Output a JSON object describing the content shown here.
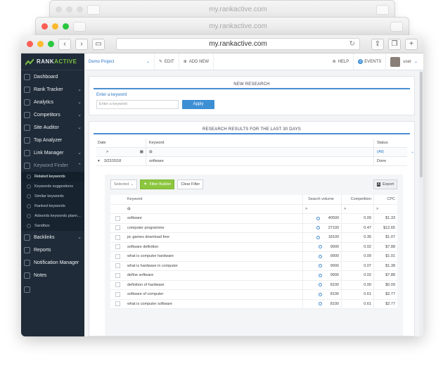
{
  "browser": {
    "url": "my.rankactive.com"
  },
  "sidebar": {
    "brand": {
      "prefix": "RANK",
      "suffix": "ACTIVE",
      "accent": "#7cc142"
    },
    "items": [
      {
        "label": "Dashboard",
        "icon": "gauge-icon",
        "chevron": false
      },
      {
        "label": "Rank Tracker",
        "icon": "chart-icon",
        "chevron": true
      },
      {
        "label": "Analytics",
        "icon": "analytics-icon",
        "chevron": true
      },
      {
        "label": "Competitors",
        "icon": "competitors-icon",
        "chevron": true
      },
      {
        "label": "Site Auditor",
        "icon": "auditor-icon",
        "chevron": true
      },
      {
        "label": "Top Analyzer",
        "icon": "analyzer-icon",
        "chevron": false
      },
      {
        "label": "Link Manager",
        "icon": "link-icon",
        "chevron": true
      },
      {
        "label": "Keyword Finder",
        "icon": "key-icon",
        "chevron": true
      }
    ],
    "sub_items": [
      {
        "label": "Related keywords",
        "active": true
      },
      {
        "label": "Keywords suggestions",
        "active": false
      },
      {
        "label": "Similar keywords",
        "active": false
      },
      {
        "label": "Ranked keywords",
        "active": false
      },
      {
        "label": "Adwords keywords plann...",
        "active": false
      },
      {
        "label": "Sandbox",
        "active": false
      }
    ],
    "items_bottom": [
      {
        "label": "Backlinks",
        "icon": "backlinks-icon",
        "chevron": true
      },
      {
        "label": "Reports",
        "icon": "reports-icon",
        "chevron": false
      },
      {
        "label": "Notification Manager",
        "icon": "bell-icon",
        "chevron": false
      },
      {
        "label": "Notes",
        "icon": "notes-icon",
        "chevron": false
      }
    ],
    "bg": "#1f2b38"
  },
  "topbar": {
    "project": "Demo Project",
    "edit": "EDIT",
    "add_new": "ADD NEW",
    "help": "HELP",
    "events": "EVENTS",
    "events_count": "0",
    "user": "user"
  },
  "research": {
    "title": "NEW RESEARCH",
    "label": "Enter a keyword",
    "placeholder": "Enter a keyword",
    "apply": "Apply"
  },
  "results": {
    "title": "RESEARCH RESULTS FOR THE LAST 30 DAYS",
    "headers": {
      "date": "Date",
      "keyword": "Keyword",
      "status": "Status"
    },
    "filter": {
      "date": ">",
      "keyword": "ф",
      "status": "(All)"
    },
    "row": {
      "date": "3/22/2018",
      "keyword": "software",
      "status": "Done"
    },
    "toolbar": {
      "selected": "Selected",
      "filter_builder": "Filter Builder",
      "clear_filter": "Clear Filter",
      "export": "Export"
    },
    "kw_headers": {
      "keyword": "Keyword",
      "volume": "Search volume",
      "competition": "Competition",
      "cpc": "CPC"
    },
    "kw_filter": {
      "keyword": "ф",
      "volume": ">",
      "competition": ">",
      "cpc": ">"
    },
    "keywords": [
      {
        "keyword": "software",
        "volume": "40500",
        "competition": "0.09",
        "cpc": "$1.33"
      },
      {
        "keyword": "computer programme",
        "volume": "27100",
        "competition": "0.47",
        "cpc": "$12.65"
      },
      {
        "keyword": "pc games download free",
        "volume": "18100",
        "competition": "0.35",
        "cpc": "$1.07"
      },
      {
        "keyword": "software definition",
        "volume": "9900",
        "competition": "0.02",
        "cpc": "$7.88"
      },
      {
        "keyword": "what is computer hardware",
        "volume": "9900",
        "competition": "0.09",
        "cpc": "$1.01"
      },
      {
        "keyword": "what is hardware in computer",
        "volume": "9900",
        "competition": "0.07",
        "cpc": "$1.38"
      },
      {
        "keyword": "define software",
        "volume": "9900",
        "competition": "0.02",
        "cpc": "$7.88"
      },
      {
        "keyword": "definition of hardware",
        "volume": "8100",
        "competition": "0.00",
        "cpc": "$0.09"
      },
      {
        "keyword": "software of computer",
        "volume": "8100",
        "competition": "0.61",
        "cpc": "$2.77"
      },
      {
        "keyword": "what is computer software",
        "volume": "8100",
        "competition": "0.61",
        "cpc": "$2.77"
      }
    ]
  },
  "colors": {
    "primary": "#3d8fd4",
    "green": "#8cc63f"
  }
}
